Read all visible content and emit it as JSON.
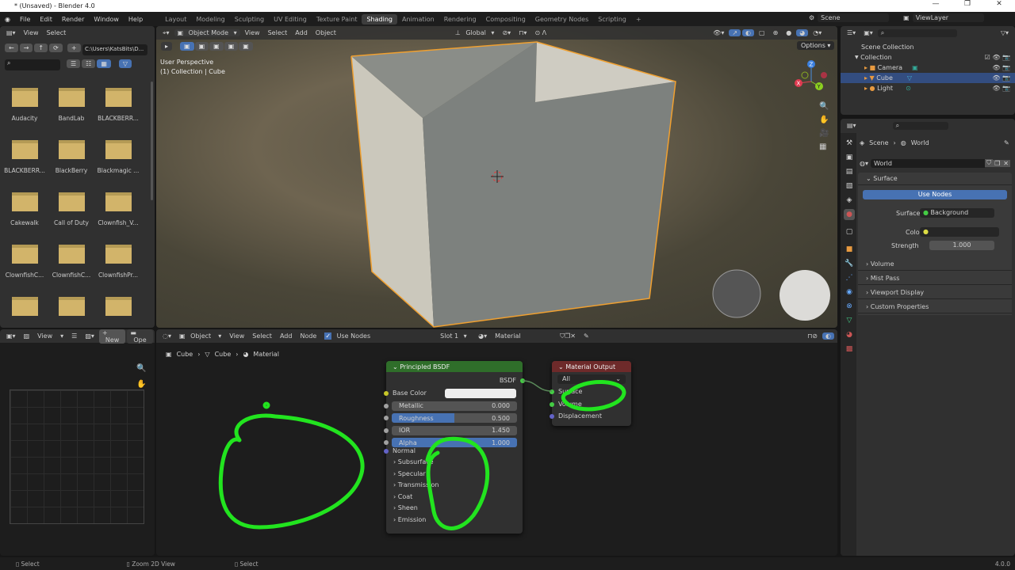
{
  "window": {
    "title": "* (Unsaved) - Blender 4.0",
    "controls": [
      "minimize",
      "maximize",
      "close"
    ]
  },
  "menu": [
    "File",
    "Edit",
    "Render",
    "Window",
    "Help"
  ],
  "workspaces": {
    "tabs": [
      "Layout",
      "Modeling",
      "Sculpting",
      "UV Editing",
      "Texture Paint",
      "Shading",
      "Animation",
      "Rendering",
      "Compositing",
      "Geometry Nodes",
      "Scripting",
      "+"
    ],
    "active": "Shading"
  },
  "scene": {
    "scene_name": "Scene",
    "view_layer": "ViewLayer"
  },
  "file_browser": {
    "header": [
      "View",
      "Select"
    ],
    "path": "C:\\Users\\KatsBits\\D...",
    "folders": [
      "Audacity",
      "BandLab",
      "BLACKBERR...",
      "BLACKBERR...",
      "BlackBerry",
      "Blackmagic ...",
      "Cakewalk",
      "Call of Duty",
      "Clownfish_V...",
      "ClownfishC...",
      "ClownfishC...",
      "ClownfishPr...",
      "",
      "",
      ""
    ],
    "folder_color": "#d2b46a"
  },
  "viewport": {
    "header": {
      "mode": "Object Mode",
      "menus": [
        "View",
        "Select",
        "Add",
        "Object"
      ],
      "orientation": "Global"
    },
    "info": [
      "User Perspective",
      "(1) Collection | Cube"
    ],
    "options_label": "Options",
    "gizmo_axes": [
      "X",
      "Y",
      "Z"
    ],
    "selection_color": "#f0a030"
  },
  "outliner": {
    "root": "Scene Collection",
    "collection": "Collection",
    "items": [
      {
        "name": "Camera",
        "selected": false
      },
      {
        "name": "Cube",
        "selected": true
      },
      {
        "name": "Light",
        "selected": false
      }
    ]
  },
  "properties": {
    "breadcrumb": [
      "Scene",
      "World"
    ],
    "datablock": "World",
    "surface_panel": "Surface",
    "use_nodes_label": "Use Nodes",
    "surface_label": "Surface",
    "surface_value": "Background",
    "color_label": "Color",
    "strength_label": "Strength",
    "strength_value": "1.000",
    "panels": [
      "Volume",
      "Mist Pass",
      "Viewport Display",
      "Custom Properties"
    ]
  },
  "image_editor": {
    "header": [
      "View"
    ],
    "new_label": "New",
    "open_label": "Ope"
  },
  "node_editor": {
    "header": {
      "object_mode": "Object",
      "menus": [
        "View",
        "Select",
        "Add",
        "Node"
      ],
      "use_nodes": "Use Nodes",
      "slot": "Slot 1",
      "material": "Material"
    },
    "breadcrumb": [
      "Cube",
      "Cube",
      "Material"
    ],
    "principled": {
      "title": "Principled BSDF",
      "output": "BSDF",
      "base_color": "Base Color",
      "fields": [
        {
          "label": "Metallic",
          "value": "0.000",
          "fill": 0
        },
        {
          "label": "Roughness",
          "value": "0.500",
          "fill": 0.5
        },
        {
          "label": "IOR",
          "value": "1.450",
          "fill": 0
        },
        {
          "label": "Alpha",
          "value": "1.000",
          "fill": 1
        }
      ],
      "normal": "Normal",
      "panels": [
        "Subsurface",
        "Specular",
        "Transmission",
        "Coat",
        "Sheen",
        "Emission"
      ],
      "header_color": "#2f6e2a"
    },
    "output_node": {
      "title": "Material Output",
      "target": "All",
      "inputs": [
        "Surface",
        "Volume",
        "Displacement"
      ],
      "header_color": "#6e2a2a"
    },
    "annotation_color": "#22e41f"
  },
  "statusbar": {
    "items": [
      "Select",
      "Zoom 2D View",
      "Select"
    ],
    "version": "4.0.0"
  }
}
